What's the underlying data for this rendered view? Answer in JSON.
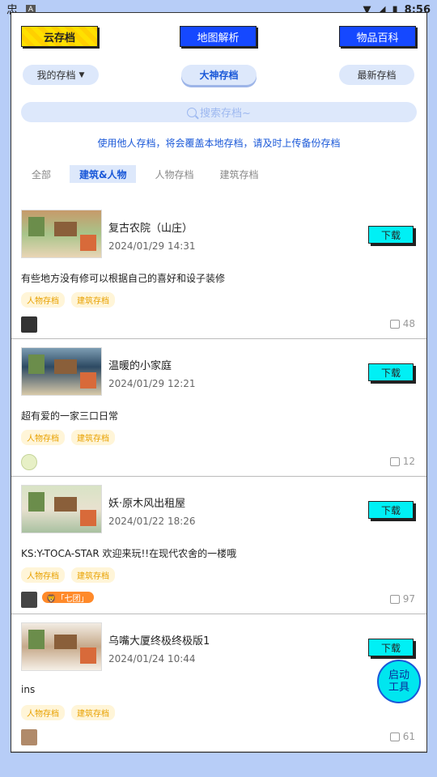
{
  "status": {
    "time": "8:56"
  },
  "top_tabs": {
    "cloud": "云存档",
    "map": "地图解析",
    "items": "物品百科"
  },
  "pills": {
    "mine": "我的存档",
    "master": "大神存档",
    "newest": "最新存档"
  },
  "search": {
    "placeholder": "搜索存档~"
  },
  "notice": "使用他人存档，将会覆盖本地存档，请及时上传备份存档",
  "filters": [
    "全部",
    "建筑&人物",
    "人物存档",
    "建筑存档"
  ],
  "list": [
    {
      "title": "复古农院（山庄）",
      "date": "2024/01/29 14:31",
      "desc": "有些地方没有修可以根据自己的喜好和设子装修",
      "tags": [
        "人物存档",
        "建筑存档"
      ],
      "likes": "48",
      "download": "下载"
    },
    {
      "title": "温暖的小家庭",
      "date": "2024/01/29 12:21",
      "desc": "超有爱的一家三口日常",
      "tags": [
        "人物存档",
        "建筑存档"
      ],
      "likes": "12",
      "download": "下载"
    },
    {
      "title": "妖·原木风出租屋",
      "date": "2024/01/22 18:26",
      "desc": "KS:Y-TOCA-STAR 欢迎来玩!!在现代农舍的一楼哦",
      "tags": [
        "人物存档",
        "建筑存档"
      ],
      "likes": "97",
      "download": "下载",
      "badge": "🦁「七团」"
    },
    {
      "title": "乌嘴大厦终极终极版1",
      "date": "2024/01/24 10:44",
      "desc": "ins",
      "tags": [
        "人物存档",
        "建筑存档"
      ],
      "likes": "61",
      "download": "下载"
    }
  ],
  "fab": {
    "line1": "启动",
    "line2": "工具"
  }
}
